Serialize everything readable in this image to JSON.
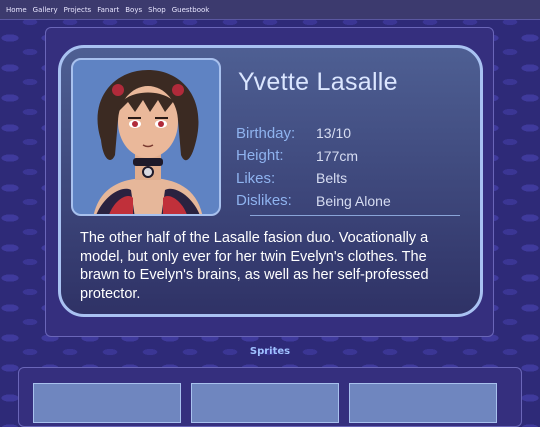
{
  "nav": {
    "items": [
      "Home",
      "Gallery",
      "Projects",
      "Fanart",
      "Boys",
      "Shop",
      "Guestbook"
    ]
  },
  "character": {
    "name": "Yvette Lasalle",
    "facts": [
      {
        "label": "Birthday:",
        "value": "13/10"
      },
      {
        "label": "Height:",
        "value": "177cm"
      },
      {
        "label": "Likes:",
        "value": "Belts"
      },
      {
        "label": "Dislikes:",
        "value": "Being Alone"
      }
    ],
    "description": "The other half of the Lasalle fasion duo. Vocationally a model, but only ever for her twin Evelyn's clothes. The brawn to Evelyn's brains, as well as her self-professed protector."
  },
  "sprites": {
    "title": "Sprites"
  },
  "colors": {
    "accent": "#8fb3ef",
    "background": "#2e2a78",
    "card_border": "#a9c2f2"
  }
}
